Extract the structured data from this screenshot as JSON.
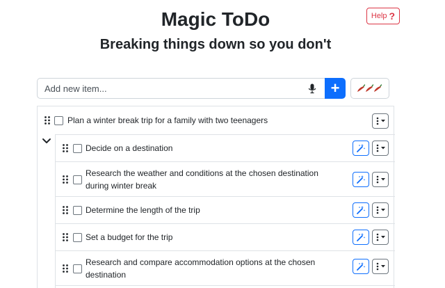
{
  "header": {
    "title": "Magic ToDo",
    "subtitle": "Breaking things down so you don't",
    "help_label": "Help",
    "help_mark": "?"
  },
  "new_item": {
    "placeholder": "Add new item...",
    "add_label": "+",
    "spice_icon": "chili-pepper-icon",
    "spice_level": 3
  },
  "tasks": {
    "parent": {
      "label": "Plan a winter break trip for a family with two teenagers",
      "expanded": true
    },
    "children": [
      {
        "line1": "Decide on a destination",
        "line2": ""
      },
      {
        "line1": "Research the weather and conditions at the chosen destination",
        "line2": "during winter break"
      },
      {
        "line1": "Determine the length of the trip",
        "line2": ""
      },
      {
        "line1": "Set a budget for the trip",
        "line2": ""
      },
      {
        "line1": "Research and compare accommodation options at the chosen",
        "line2": "destination"
      }
    ]
  },
  "colors": {
    "primary": "#0d6efd",
    "danger": "#dc3545",
    "border": "#dee2e6",
    "chili": "#c0392b"
  }
}
